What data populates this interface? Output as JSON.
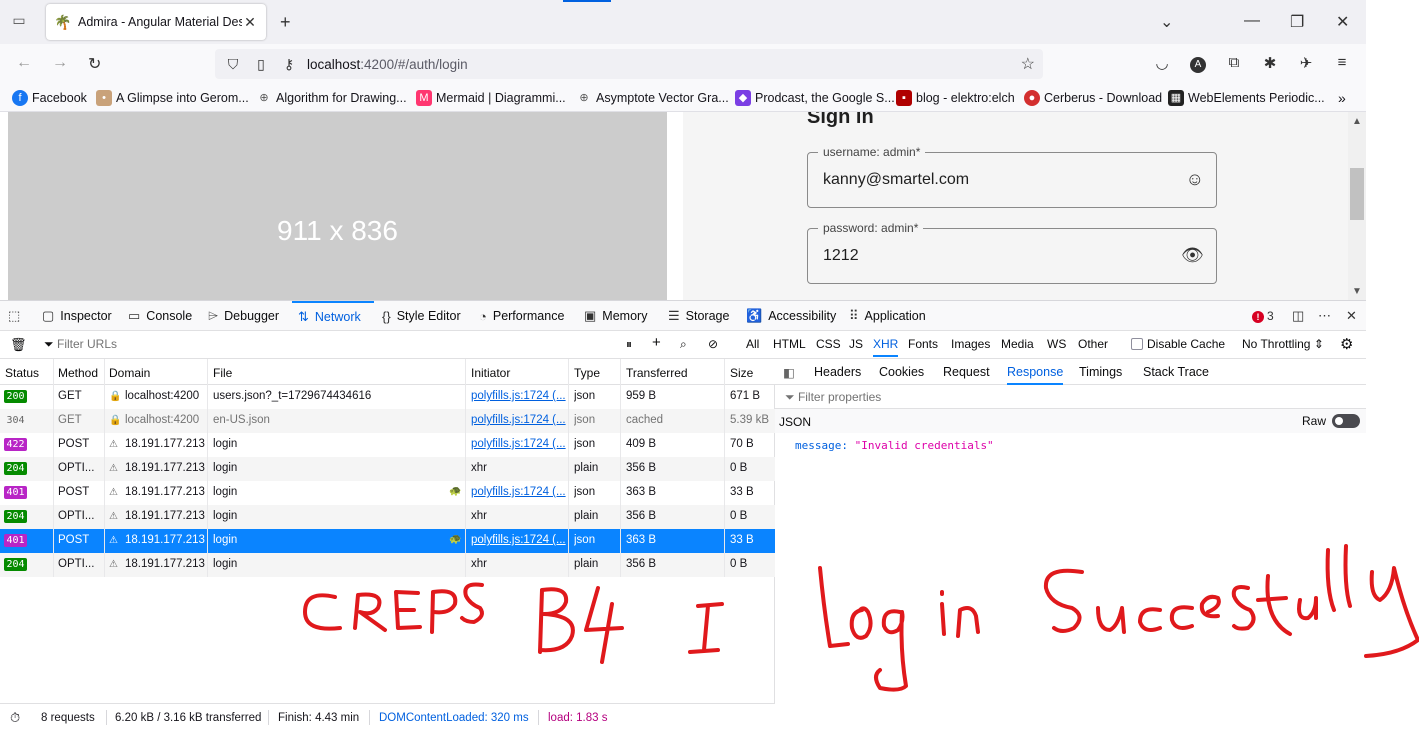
{
  "browser": {
    "tab_title": "Admira - Angular Material Desig",
    "url_host": "localhost",
    "url_path": ":4200/#/auth/login",
    "icons": {
      "tab_list": "tab-list-icon",
      "favicon": "palm-tree-icon",
      "close": "close-icon",
      "new_tab": "plus-icon",
      "minimize": "minimize-icon",
      "restore": "restore-icon",
      "back": "back-arrow-icon",
      "forward": "forward-arrow-icon",
      "reload": "reload-icon",
      "shield": "shield-icon",
      "page": "page-icon",
      "permissions": "key-icon",
      "bookmark": "star-icon",
      "pocket": "pocket-icon",
      "account": "account-icon",
      "extensions": "puzzle-icon",
      "menu": "hamburger-icon"
    }
  },
  "bookmarks": [
    {
      "label": "Facebook",
      "color": "#1877f2",
      "glyph": "f"
    },
    {
      "label": "A Glimpse into Gerom...",
      "color": "#c9a27a",
      "glyph": "•"
    },
    {
      "label": "Algorithm for Drawing...",
      "color": "#555555",
      "glyph": "⊕"
    },
    {
      "label": "Mermaid | Diagrammi...",
      "color": "#ff3670",
      "glyph": "M"
    },
    {
      "label": "Asymptote Vector Gra...",
      "color": "#555555",
      "glyph": "⊕"
    },
    {
      "label": "Prodcast, the Google S...",
      "color": "#7b3fe4",
      "glyph": "◆"
    },
    {
      "label": "blog - elektro:elch",
      "color": "#b00000",
      "glyph": "▪"
    },
    {
      "label": "Cerberus - Download",
      "color": "#d32f2f",
      "glyph": "●"
    },
    {
      "label": "WebElements Periodic...",
      "color": "#222222",
      "glyph": "▦"
    }
  ],
  "page": {
    "placeholder_text": "911 x 836",
    "heading": "Sign in",
    "username_label": "username: admin*",
    "username_value": "kanny@smartel.com",
    "password_label": "password: admin*",
    "password_value": "1212"
  },
  "devtools": {
    "tabs": [
      "Inspector",
      "Console",
      "Debugger",
      "Network",
      "Style Editor",
      "Performance",
      "Memory",
      "Storage",
      "Accessibility",
      "Application"
    ],
    "selected_tab": "Network",
    "error_count": "3",
    "filter_placeholder": "Filter URLs",
    "type_filters": [
      "All",
      "HTML",
      "CSS",
      "JS",
      "XHR",
      "Fonts",
      "Images",
      "Media",
      "WS",
      "Other"
    ],
    "selected_type": "XHR",
    "disable_cache": "Disable Cache",
    "throttling": "No Throttling ⇕",
    "columns": [
      "Status",
      "Method",
      "Domain",
      "File",
      "Initiator",
      "Type",
      "Transferred",
      "Size"
    ],
    "rows": [
      {
        "status": "200",
        "method": "GET",
        "domain": "localhost:4200",
        "file": "users.json?_t=1729674434616",
        "initiator": "polyfills.js:1724 (...",
        "type": "json",
        "transferred": "959 B",
        "size": "671 B"
      },
      {
        "status": "304",
        "method": "GET",
        "domain": "localhost:4200",
        "file": "en-US.json",
        "initiator": "polyfills.js:1724 (...",
        "type": "json",
        "transferred": "cached",
        "size": "5.39 kB"
      },
      {
        "status": "422",
        "method": "POST",
        "domain": "18.191.177.213",
        "file": "login",
        "initiator": "polyfills.js:1724 (...",
        "type": "json",
        "transferred": "409 B",
        "size": "70 B"
      },
      {
        "status": "204",
        "method": "OPTI...",
        "domain": "18.191.177.213",
        "file": "login",
        "initiator": "xhr",
        "type": "plain",
        "transferred": "356 B",
        "size": "0 B"
      },
      {
        "status": "401",
        "method": "POST",
        "domain": "18.191.177.213",
        "file": "login",
        "initiator": "polyfills.js:1724 (...",
        "type": "json",
        "transferred": "363 B",
        "size": "33 B"
      },
      {
        "status": "204",
        "method": "OPTI...",
        "domain": "18.191.177.213",
        "file": "login",
        "initiator": "xhr",
        "type": "plain",
        "transferred": "356 B",
        "size": "0 B"
      },
      {
        "status": "401",
        "method": "POST",
        "domain": "18.191.177.213",
        "file": "login",
        "initiator": "polyfills.js:1724 (...",
        "type": "json",
        "transferred": "363 B",
        "size": "33 B"
      },
      {
        "status": "204",
        "method": "OPTI...",
        "domain": "18.191.177.213",
        "file": "login",
        "initiator": "xhr",
        "type": "plain",
        "transferred": "356 B",
        "size": "0 B"
      }
    ],
    "selected_row": 6,
    "side_tabs": [
      "Headers",
      "Cookies",
      "Request",
      "Response",
      "Timings",
      "Stack Trace"
    ],
    "selected_side_tab": "Response",
    "side_filter": "Filter properties",
    "json_label": "JSON",
    "raw_label": "Raw",
    "response_key": "message:",
    "response_value": "\"Invalid credentials\"",
    "status": {
      "requests": "8 requests",
      "transferred": "6.20 kB / 3.16 kB transferred",
      "finish": "Finish: 4.43 min",
      "dcl": "DOMContentLoaded: 320 ms",
      "load": "load: 1.83 s"
    }
  },
  "annotation": {
    "text": "CREPS B4 I Log in Successfully",
    "color": "#e0191c"
  }
}
